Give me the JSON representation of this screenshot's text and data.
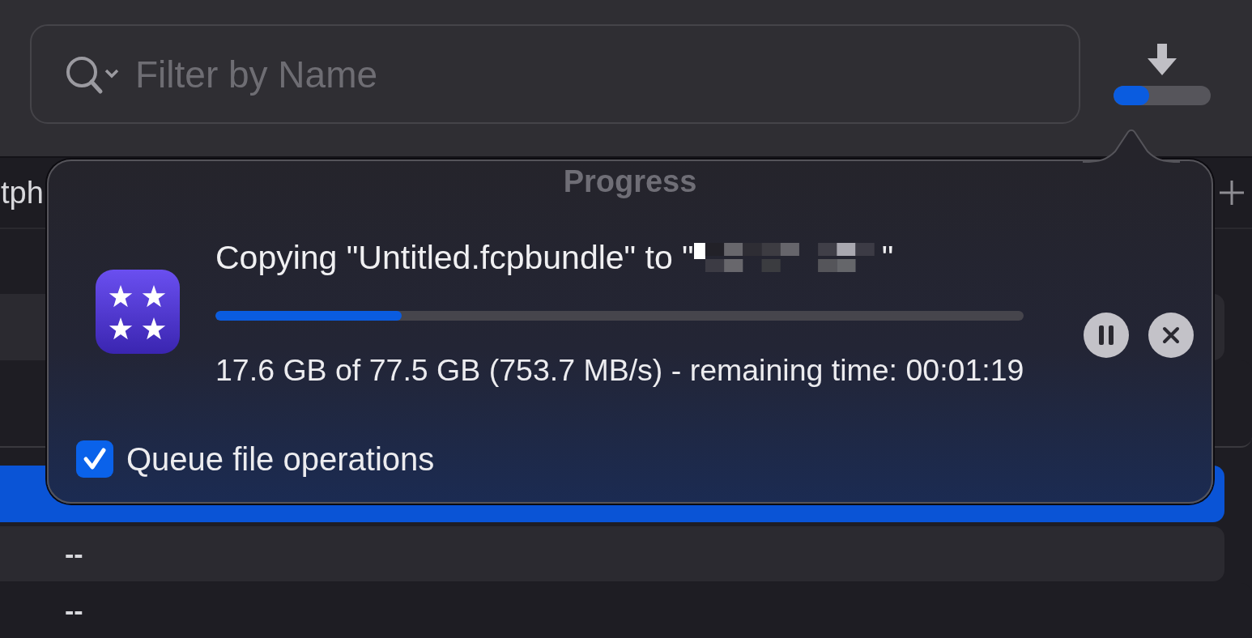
{
  "toolbar": {
    "search": {
      "placeholder": "Filter by Name"
    },
    "download_progress": {
      "level": 0.37
    }
  },
  "list": {
    "tab_label": "tph",
    "rows": [
      {
        "kind": "shaded",
        "selected": false
      },
      {
        "kind": "plain",
        "selected": false
      },
      {
        "kind": "plain",
        "selected": true
      },
      {
        "kind": "shaded",
        "cell": "--",
        "selected": false
      },
      {
        "kind": "plain",
        "cell": "--",
        "selected": false
      }
    ]
  },
  "popover": {
    "title": "Progress",
    "operation": {
      "text_before": "Copying \"Untitled.fcpbundle\" to \"",
      "text_after": "\"",
      "level": 0.23,
      "stats": "17.6 GB of 77.5 GB (753.7 MB/s) - remaining time: 00:01:19"
    },
    "queue_option": {
      "label": "Queue file operations",
      "checked": true
    }
  }
}
